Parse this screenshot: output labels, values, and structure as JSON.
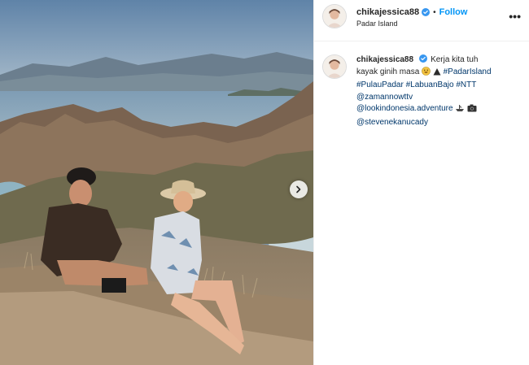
{
  "photo": {
    "description_icon": "landscape-photo",
    "next_icon": "chevron-right-icon"
  },
  "header": {
    "username": "chikajessica88",
    "separator": "•",
    "follow_label": "Follow",
    "location": "Padar Island",
    "more_icon": "more-options-icon"
  },
  "caption": {
    "username": "chikajessica88",
    "text_1": "Kerja kita tuh kayak ginih masa",
    "hashtag_1": "#PadarIsland",
    "hashtag_2": "#PulauPadar",
    "hashtag_3": "#LabuanBajo",
    "hashtag_4": "#NTT",
    "mention_1": "@zamannowttv",
    "mention_2": "@lookindonesia.adventure",
    "mention_3": "@stevenekanucady"
  },
  "colors": {
    "link": "#00376b",
    "follow": "#0095f6",
    "verified": "#3897f0"
  }
}
